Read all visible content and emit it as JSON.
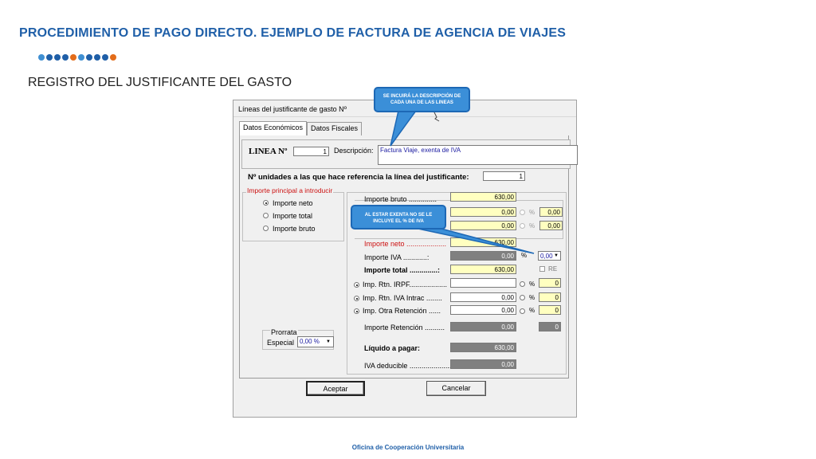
{
  "slide": {
    "title": "PROCEDIMIENTO DE PAGO DIRECTO. EJEMPLO DE FACTURA DE AGENCIA DE VIAJES",
    "subtitle": "REGISTRO DEL JUSTIFICANTE DEL GASTO",
    "footer": "Oficina de Cooperación Universitaria",
    "dot_colors": [
      "#3f8fd2",
      "#1f5fa8",
      "#1f5fa8",
      "#1f5fa8",
      "#e36c1a",
      "#3f8fd2",
      "#1f5fa8",
      "#1f5fa8",
      "#1f5fa8",
      "#e36c1a"
    ]
  },
  "callouts": {
    "descripcion": "SE INCUIRÁ LA DESCRIPCIÓN DE CADA UNA DE LAS LINEAS",
    "exenta": "AL ESTAR EXENTA NO SE LE INCLUYE EL % DE IVA"
  },
  "dialog": {
    "title": "Líneas del justificante de gasto Nº",
    "tabs": [
      "Datos Económicos",
      "Datos Fiscales"
    ],
    "linea_label": "LINEA Nº",
    "linea_value": "1",
    "descripcion_label": "Descripción:",
    "descripcion_value": "Factura Viaje, exenta de IVA",
    "nunidades_label": "Nº unidades a las que hace referencia la línea del justificante:",
    "nunidades_value": "1",
    "importe_group": {
      "legend": "Importe principal a introducir",
      "options": [
        "Importe neto",
        "Importe total",
        "Importe bruto"
      ],
      "selected": "Importe neto"
    },
    "importe_bruto": {
      "label": "Importe bruto ..............",
      "value": "630,00"
    },
    "extra1": {
      "value": "0,00",
      "pct": "%",
      "pct_value": "0,00"
    },
    "extra2": {
      "value": "0,00",
      "pct": "%",
      "pct_value": "0,00"
    },
    "importe_neto": {
      "label": "Importe neto ....................",
      "value": "630,00"
    },
    "importe_iva": {
      "label": "Importe IVA ............:",
      "value": "0,00",
      "pct": "%",
      "select": "0,00"
    },
    "importe_total": {
      "label": "Importe total ..............:",
      "value": "630,00",
      "re": "RE"
    },
    "rtn_irpf": {
      "label": "Imp. Rtn. IRPF...................",
      "value": "",
      "pct": "%",
      "pct_value": "0"
    },
    "rtn_iva": {
      "label": "Imp. Rtn. IVA Intrac ........",
      "value": "0,00",
      "pct": "%",
      "pct_value": "0"
    },
    "rtn_otra": {
      "label": "Imp. Otra Retención ......",
      "value": "0,00",
      "pct": "%",
      "pct_value": "0"
    },
    "importe_retencion": {
      "label": "Importe Retención ..........",
      "value": "0,00",
      "extra": "0"
    },
    "liquido": {
      "label": "Líquido a pagar:",
      "value": "630,00"
    },
    "iva_deducible": {
      "label": "IVA deducible .......................",
      "value": "0,00"
    },
    "prorrata": {
      "legend": "Prorrata",
      "label": "Especial",
      "value": "0,00 %"
    },
    "buttons": {
      "accept": "Aceptar",
      "cancel": "Cancelar"
    }
  }
}
